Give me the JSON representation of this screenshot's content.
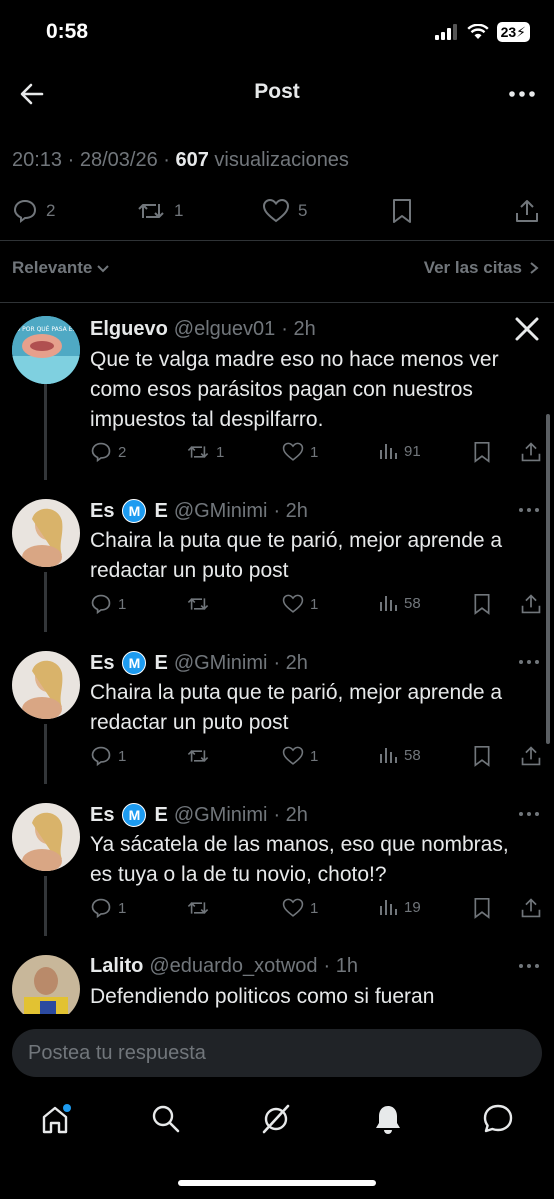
{
  "status_bar": {
    "time": "0:58",
    "battery": "23"
  },
  "header": {
    "title": "Post"
  },
  "post": {
    "time": "20:13",
    "date": "28/03/26",
    "views_count": "607",
    "views_label": "visualizaciones",
    "replies": "2",
    "reposts": "1",
    "likes": "5"
  },
  "filter": {
    "sort_label": "Relevante",
    "quotes_label": "Ver las citas"
  },
  "replies": [
    {
      "name": "Elguevo",
      "handle": "@elguev01",
      "time": "· 2h",
      "text": "Que te valga madre eso no hace menos ver como esos parásitos pagan con nuestros impuestos tal despilfarro.",
      "replies": "2",
      "reposts": "1",
      "likes": "1",
      "views": "91",
      "avatar_text": "OYE PERO POR QUÉ PASA ESO A QUE"
    },
    {
      "name_a": "Es",
      "badge": "M",
      "name_b": "E",
      "handle": "@GMinimi",
      "time": "· 2h",
      "text": "Chaira la puta que te parió, mejor  aprende a redactar un puto post",
      "replies": "1",
      "reposts": "",
      "likes": "1",
      "views": "58"
    },
    {
      "name_a": "Es",
      "badge": "M",
      "name_b": "E",
      "handle": "@GMinimi",
      "time": "· 2h",
      "text": "Chaira la puta que te parió, mejor  aprende a redactar un puto post",
      "replies": "1",
      "reposts": "",
      "likes": "1",
      "views": "58"
    },
    {
      "name_a": "Es",
      "badge": "M",
      "name_b": "E",
      "handle": "@GMinimi",
      "time": "· 2h",
      "text": "Ya sácatela de las manos, eso que nombras, es tuya o la de tu novio, choto!?",
      "replies": "1",
      "reposts": "",
      "likes": "1",
      "views": "19"
    },
    {
      "name": "Lalito",
      "handle": "@eduardo_xotwod",
      "time": "· 1h",
      "text": "Defendiendo politicos como si fueran"
    }
  ],
  "compose": {
    "placeholder": "Postea tu respuesta"
  },
  "tabs": [
    "home-icon",
    "search-icon",
    "grok-icon",
    "notifications-icon",
    "messages-icon"
  ],
  "colors": {
    "accent": "#1d9bf0",
    "muted": "#71767b",
    "text": "#e7e9ea",
    "background": "#000000"
  }
}
